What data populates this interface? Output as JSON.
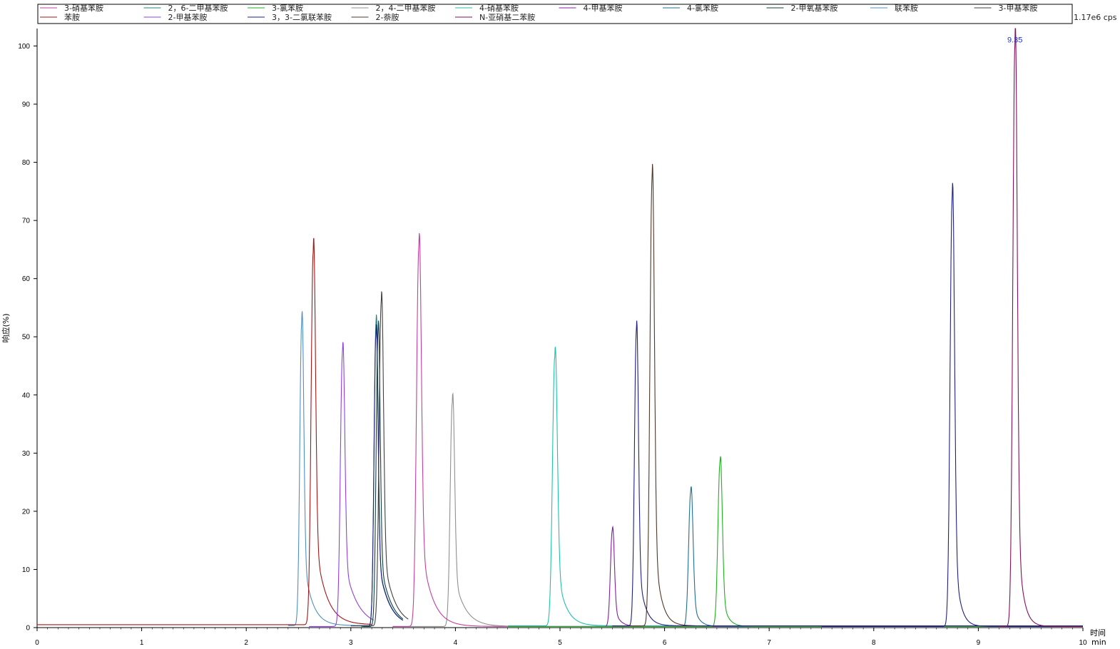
{
  "chart_data": {
    "type": "line",
    "scale_label": "1.17e6 cps",
    "ylabel": "响应(%)",
    "xlabel": "时间",
    "x_unit": "min",
    "xlim": [
      0,
      10
    ],
    "ylim": [
      0,
      103
    ],
    "x_ticks": [
      0,
      1,
      2,
      3,
      4,
      5,
      6,
      7,
      8,
      9,
      10
    ],
    "y_ticks": [
      0,
      10,
      20,
      30,
      40,
      50,
      60,
      70,
      80,
      90,
      100
    ],
    "peak_label": {
      "x": 9.35,
      "y": 100,
      "text": "9.35"
    },
    "legend_rows": [
      [
        {
          "name": "3-硝基苯胺",
          "color": "#c040a0"
        },
        {
          "name": "2，6-二甲基苯胺",
          "color": "#208080"
        },
        {
          "name": "3-氯苯胺",
          "color": "#20b020"
        },
        {
          "name": "2，4-二甲基苯胺",
          "color": "#909090"
        },
        {
          "name": "4-硝基苯胺",
          "color": "#20c0b0"
        },
        {
          "name": "4-甲基苯胺",
          "color": "#8020a0"
        },
        {
          "name": "4-氯苯胺",
          "color": "#207090"
        },
        {
          "name": "2-甲氧基苯胺",
          "color": "#104040"
        },
        {
          "name": "联苯胺",
          "color": "#5090c0"
        },
        {
          "name": "3-甲基苯胺",
          "color": "#404040"
        }
      ],
      [
        {
          "name": "苯胺",
          "color": "#a01818"
        },
        {
          "name": "2-甲基苯胺",
          "color": "#9040e0"
        },
        {
          "name": "3，3-二氯联苯胺",
          "color": "#202080"
        },
        {
          "name": "2-萘胺",
          "color": "#503828"
        },
        {
          "name": "N-亚硝基二苯胺",
          "color": "#801060"
        }
      ]
    ],
    "series": [
      {
        "name": "联苯胺",
        "color": "#5090c0",
        "peak_x": 2.53,
        "peak_y": 52,
        "width": 0.018,
        "tail": 0.08,
        "baseline": 0.35,
        "start": 2.4,
        "end": 3.2
      },
      {
        "name": "苯胺",
        "color": "#a01818",
        "peak_x": 2.64,
        "peak_y": 64,
        "width": 0.02,
        "tail": 0.1,
        "baseline": 0.5,
        "start": 0,
        "end": 3.2
      },
      {
        "name": "2-甲基苯胺",
        "color": "#9040e0",
        "peak_x": 2.92,
        "peak_y": 47,
        "width": 0.02,
        "tail": 0.12,
        "baseline": 0.2,
        "start": 2.6,
        "end": 3.22
      },
      {
        "name": "2，6-二甲基苯胺",
        "color": "#208080",
        "peak_x": 3.24,
        "peak_y": 51.5,
        "width": 0.018,
        "tail": 0.1,
        "baseline": 0.2,
        "start": 3.1,
        "end": 3.5
      },
      {
        "name": "3，3-二氯联苯胺",
        "color": "#202080",
        "peak_x": 3.24,
        "peak_y": 50,
        "width": 0.018,
        "tail": 0.1,
        "baseline": 0.2,
        "start": 3.12,
        "end": 3.5
      },
      {
        "name": "2-甲氧基苯胺",
        "color": "#104040",
        "peak_x": 3.26,
        "peak_y": 50.5,
        "width": 0.018,
        "tail": 0.1,
        "baseline": 0.2,
        "start": 3.12,
        "end": 3.5
      },
      {
        "name": "3-甲基苯胺",
        "color": "#404040",
        "peak_x": 3.29,
        "peak_y": 55.3,
        "width": 0.02,
        "tail": 0.1,
        "baseline": 0.3,
        "start": 3.0,
        "end": 3.55
      },
      {
        "name": "2，4-二甲基苯胺",
        "color": "#909090",
        "peak_x": 3.97,
        "peak_y": 38.5,
        "width": 0.02,
        "tail": 0.1,
        "baseline": 0.2,
        "start": 3.4,
        "end": 4.5
      },
      {
        "name": "3-硝基苯胺",
        "color": "#c040a0",
        "peak_x": 3.65,
        "peak_y": 65,
        "width": 0.022,
        "tail": 0.1,
        "baseline": 0.2,
        "start": 3.4,
        "end": 4.5
      },
      {
        "name": "4-硝基苯胺",
        "color": "#20c0b0",
        "peak_x": 4.95,
        "peak_y": 46.2,
        "width": 0.022,
        "tail": 0.08,
        "baseline": 0.3,
        "start": 4.5,
        "end": 10
      },
      {
        "name": "4-甲基苯胺",
        "color": "#8020a0",
        "peak_x": 5.5,
        "peak_y": 16.5,
        "width": 0.018,
        "tail": 0.05,
        "baseline": 0.2,
        "start": 4.5,
        "end": 10
      },
      {
        "name": "4-氯苯胺",
        "color": "#207090",
        "peak_x": 6.25,
        "peak_y": 23.2,
        "width": 0.02,
        "tail": 0.05,
        "baseline": 0.2,
        "start": 4.5,
        "end": 10
      },
      {
        "name": "3-氯苯胺",
        "color": "#20b020",
        "peak_x": 6.53,
        "peak_y": 28.2,
        "width": 0.02,
        "tail": 0.05,
        "baseline": 0.2,
        "start": 4.5,
        "end": 10
      },
      {
        "name": "2-萘胺",
        "color": "#503828",
        "peak_x": 5.88,
        "peak_y": 76.5,
        "width": 0.02,
        "tail": 0.06,
        "baseline": 0.3,
        "start": 5.5,
        "end": 6.3
      },
      {
        "name": "3，3-二氯联苯胺",
        "color": "#202080",
        "peak_x": 5.73,
        "peak_y": 50.5,
        "width": 0.018,
        "tail": 0.06,
        "baseline": 0.3,
        "start": 5.5,
        "end": 10
      },
      {
        "name": "3，3-二氯联苯胺",
        "color": "#202080",
        "peak_x": 8.75,
        "peak_y": 73.5,
        "width": 0.02,
        "tail": 0.05,
        "baseline": 0.2,
        "start": 7.5,
        "end": 10
      },
      {
        "name": "N-亚硝基二苯胺",
        "color": "#801060",
        "peak_x": 9.35,
        "peak_y": 100,
        "width": 0.02,
        "tail": 0.05,
        "baseline": 0.2,
        "start": 9.2,
        "end": 10
      }
    ]
  }
}
